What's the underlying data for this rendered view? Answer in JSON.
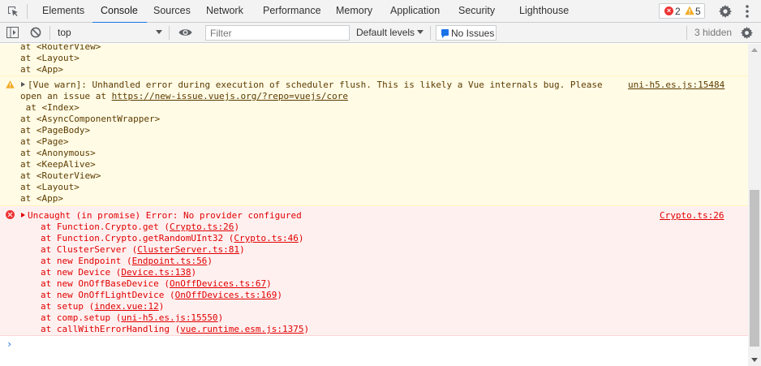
{
  "tabs": [
    "Elements",
    "Console",
    "Sources",
    "Network",
    "Performance",
    "Memory",
    "Application",
    "Security",
    "Lighthouse"
  ],
  "active_tab": "Console",
  "counts": {
    "errors": "2",
    "warnings": "5"
  },
  "toolbar": {
    "context": "top",
    "filter_placeholder": "Filter",
    "levels": "Default levels",
    "issues": "No Issues",
    "hidden": "3 hidden"
  },
  "colors": {
    "accent": "#1a73e8",
    "warning_bg": "#fffbe5",
    "warning_text": "#5c3c00",
    "error_bg": "#fff0f0",
    "error_text": "#e00000"
  },
  "console": {
    "prev_warning_tail": [
      "at <RouterView>",
      "at <Layout>",
      "at <App>"
    ],
    "vue_warning": {
      "line1": "[Vue warn]: Unhandled error during execution of scheduler flush. This is likely a Vue internals bug. Please",
      "line2_prefix": "open an issue at ",
      "link": "https://new-issue.vuejs.org/?repo=vuejs/core",
      "source": "uni-h5.es.js:15484",
      "stack": [
        " at <Index>",
        "at <AsyncComponentWrapper>",
        "at <PageBody>",
        "at <Page>",
        "at <Anonymous>",
        "at <KeepAlive>",
        "at <RouterView>",
        "at <Layout>",
        "at <App>"
      ]
    },
    "error": {
      "message": "Uncaught (in promise) Error: No provider configured",
      "source": "Crypto.ts:26",
      "stack": [
        {
          "prefix": "at Function.Crypto.get (",
          "loc": "Crypto.ts:26",
          "suffix": ")"
        },
        {
          "prefix": "at Function.Crypto.getRandomUInt32 (",
          "loc": "Crypto.ts:46",
          "suffix": ")"
        },
        {
          "prefix": "at ClusterServer (",
          "loc": "ClusterServer.ts:81",
          "suffix": ")"
        },
        {
          "prefix": "at new Endpoint (",
          "loc": "Endpoint.ts:56",
          "suffix": ")"
        },
        {
          "prefix": "at new Device (",
          "loc": "Device.ts:138",
          "suffix": ")"
        },
        {
          "prefix": "at new OnOffBaseDevice (",
          "loc": "OnOffDevices.ts:67",
          "suffix": ")"
        },
        {
          "prefix": "at new OnOffLightDevice (",
          "loc": "OnOffDevices.ts:169",
          "suffix": ")"
        },
        {
          "prefix": "at setup (",
          "loc": "index.vue:12",
          "suffix": ")"
        },
        {
          "prefix": "at comp.setup (",
          "loc": "uni-h5.es.js:15550",
          "suffix": ")"
        },
        {
          "prefix": "at callWithErrorHandling (",
          "loc": "vue.runtime.esm.js:1375",
          "suffix": ")"
        }
      ]
    },
    "prompt": "›"
  }
}
